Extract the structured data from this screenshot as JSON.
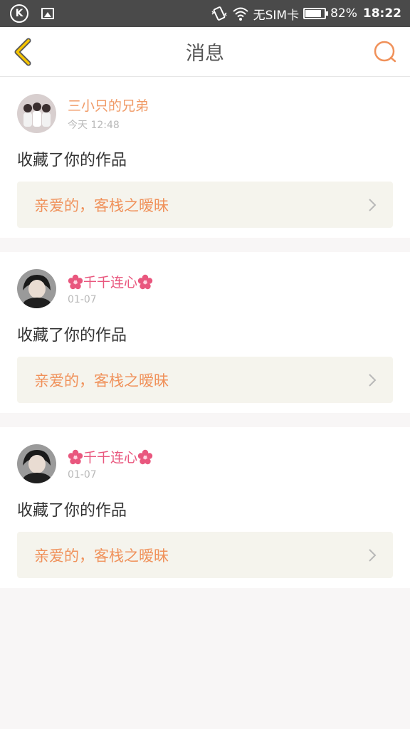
{
  "status_bar": {
    "carrier": "无SIM卡",
    "battery": "82%",
    "time": "18:22"
  },
  "header": {
    "title": "消息"
  },
  "messages": [
    {
      "user": "三小只的兄弟",
      "time": "今天 12:48",
      "action": "收藏了你的作品",
      "work": "亲爱的，客栈之暧昧"
    },
    {
      "user": "千千连心",
      "time": "01-07",
      "action": "收藏了你的作品",
      "work": "亲爱的，客栈之暧昧"
    },
    {
      "user": "千千连心",
      "time": "01-07",
      "action": "收藏了你的作品",
      "work": "亲爱的，客栈之暧昧"
    }
  ],
  "colors": {
    "accent": "#f0915a",
    "back_arrow": "#f5c400",
    "link_bg": "#f5f4ed"
  },
  "icons": {
    "back": "back-arrow-icon",
    "search": "search-icon",
    "chevron": "chevron-right-icon",
    "flower": "flower-icon"
  }
}
